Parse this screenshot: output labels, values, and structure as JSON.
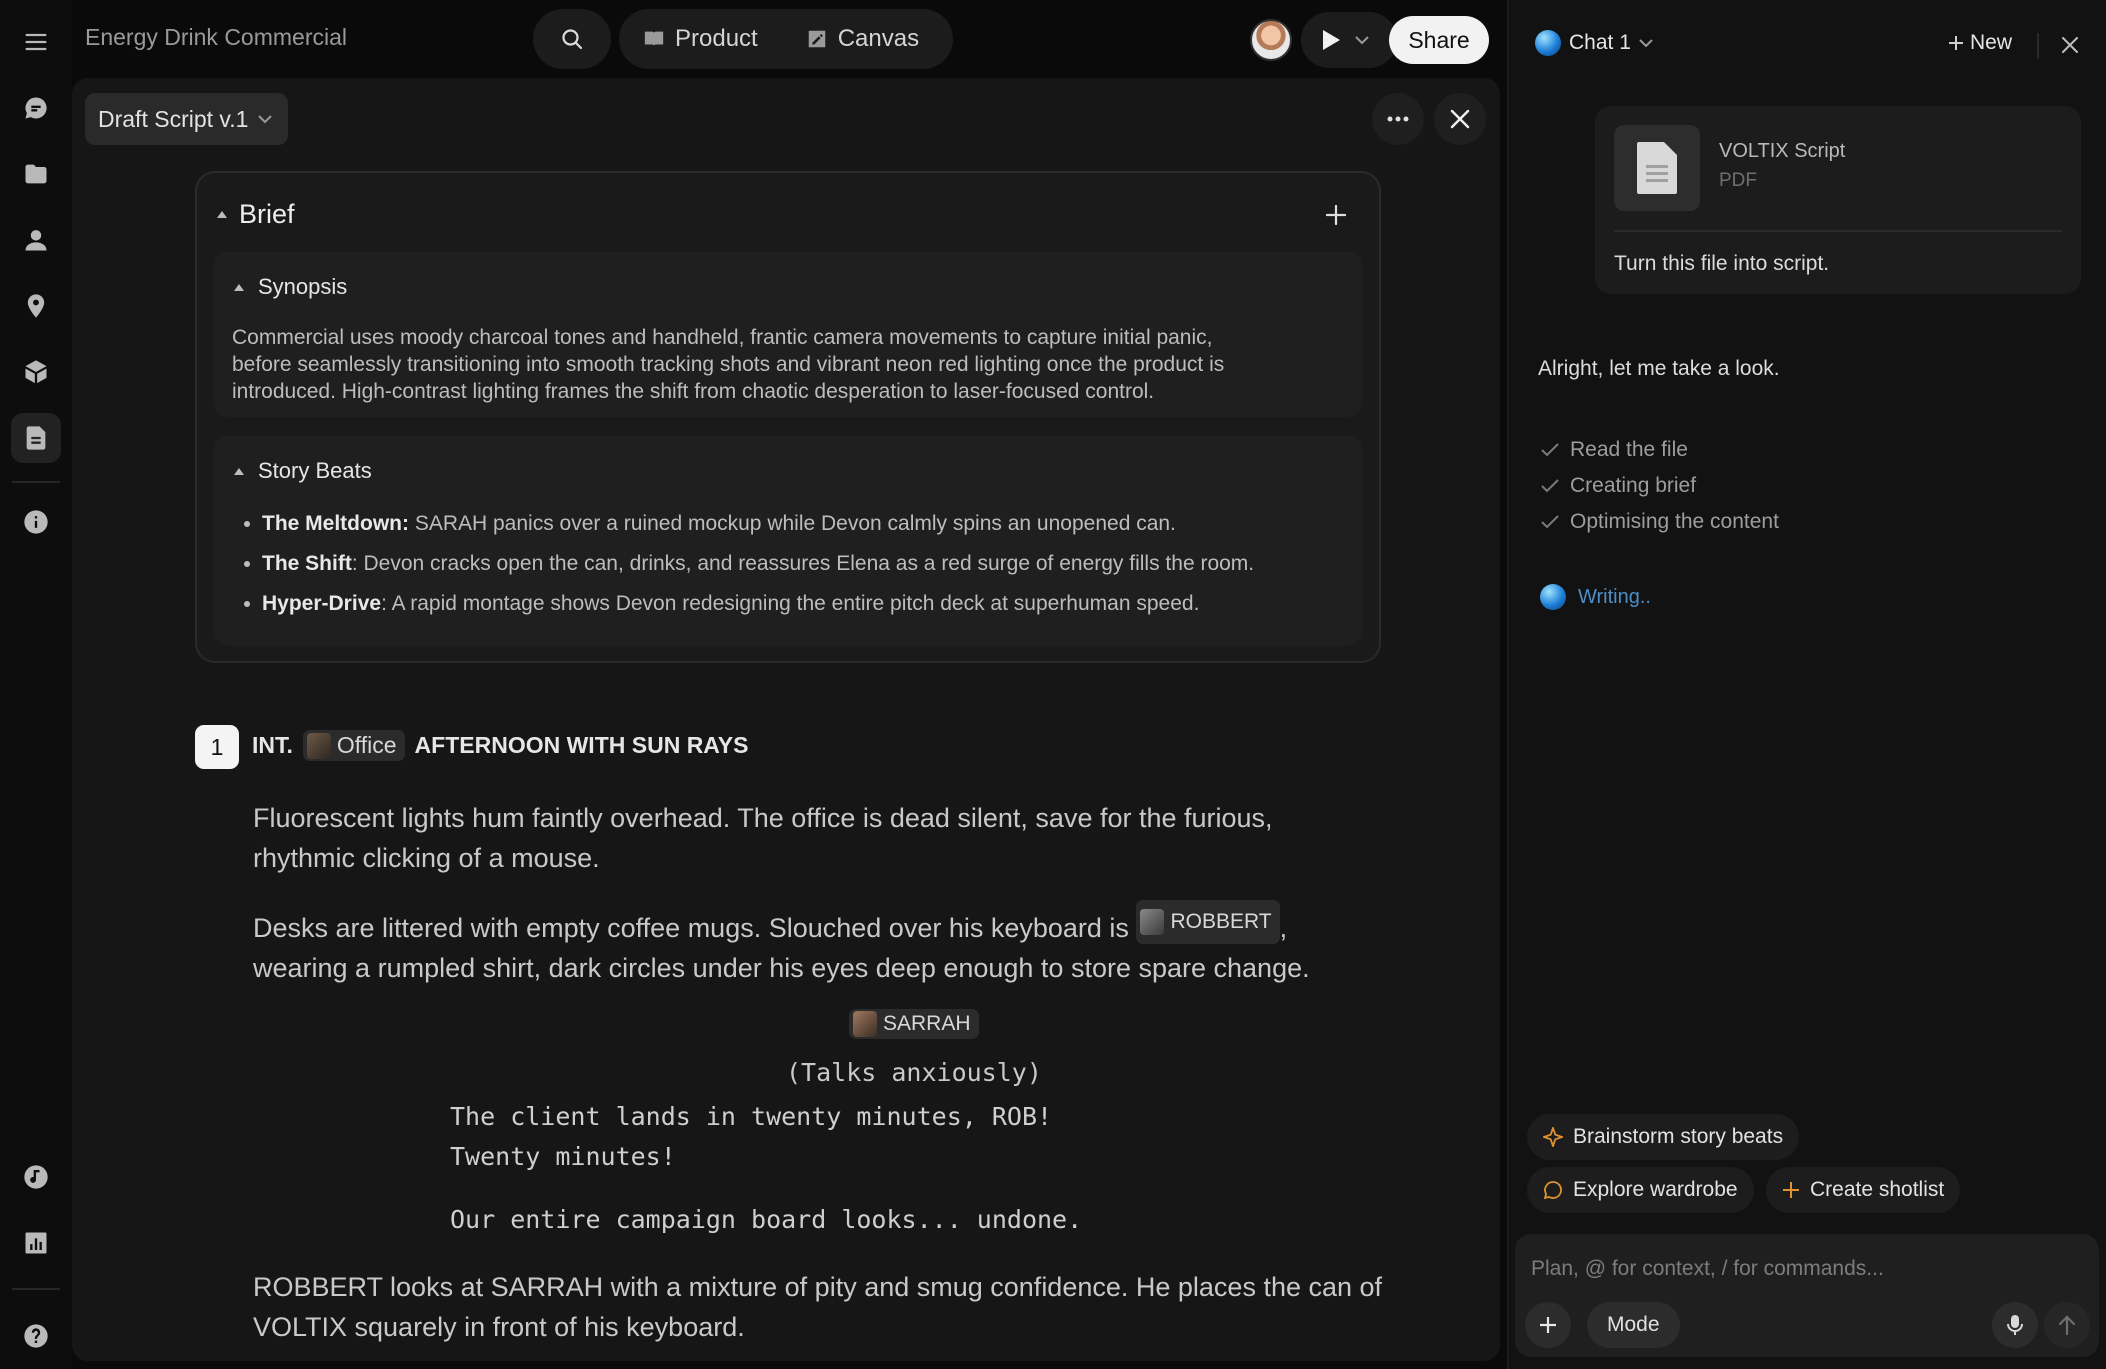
{
  "app": {
    "project_title": "Energy Drink Commercial",
    "tabs": [
      {
        "label": "Product",
        "icon": "book-icon"
      },
      {
        "label": "Canvas",
        "icon": "pencil-square-icon"
      }
    ],
    "share_label": "Share"
  },
  "sidebar": {
    "items": [
      {
        "name": "menu",
        "icon": "hamburger-icon"
      },
      {
        "name": "chats",
        "icon": "chat-bubble-icon"
      },
      {
        "name": "files",
        "icon": "folder-icon"
      },
      {
        "name": "characters",
        "icon": "person-icon"
      },
      {
        "name": "locations",
        "icon": "location-pin-icon"
      },
      {
        "name": "products",
        "icon": "cube-icon"
      },
      {
        "name": "scripts",
        "icon": "document-icon",
        "active": true
      },
      {
        "name": "info",
        "icon": "info-icon"
      },
      {
        "name": "music",
        "icon": "music-note-icon"
      },
      {
        "name": "analytics",
        "icon": "bar-chart-icon"
      },
      {
        "name": "help",
        "icon": "help-icon"
      }
    ]
  },
  "document": {
    "version_label": "Draft Script v.1",
    "brief": {
      "title": "Brief",
      "synopsis_title": "Synopsis",
      "synopsis_lines": [
        "Commercial uses moody charcoal tones and handheld, frantic camera movements to capture initial panic,",
        "before seamlessly transitioning into smooth tracking shots and vibrant neon red lighting once the product is",
        "introduced. High-contrast lighting frames the shift from chaotic desperation to laser-focused control."
      ],
      "beats_title": "Story Beats",
      "beats": [
        {
          "label": "The Meltdown:",
          "text": " SARAH panics over a ruined mockup while Devon calmly spins an unopened can."
        },
        {
          "label": "The Shift",
          "text": ": Devon cracks open the can, drinks, and reassures Elena as a red surge of energy fills the room."
        },
        {
          "label": "Hyper-Drive",
          "text": ": A rapid montage shows Devon redesigning the entire pitch deck at superhuman speed."
        }
      ]
    },
    "scene": {
      "number": "1",
      "int_ext": "INT.",
      "location": "Office",
      "time": "AFTERNOON WITH SUN RAYS",
      "action1_lines": [
        "Fluorescent lights hum faintly overhead. The office is dead silent, save for the furious,",
        "rhythmic clicking of a mouse."
      ],
      "action2_before": "Desks are littered with empty coffee mugs. Slouched over his keyboard is",
      "action2_character": "ROBBERT",
      "action2_after": ",",
      "action2_line2": "wearing a rumpled shirt, dark circles under his eyes deep enough to store spare change.",
      "character": "SARRAH",
      "parenthetical": "(Talks anxiously)",
      "dialogue1": [
        "The client lands in twenty minutes, ROB!",
        "Twenty minutes!"
      ],
      "dialogue2": "Our entire campaign board looks... undone.",
      "action3_lines": [
        "ROBBERT looks at SARRAH with a mixture of pity and smug confidence. He places the can of",
        "VOLTIX squarely in front of his keyboard."
      ]
    }
  },
  "chat": {
    "title": "Chat 1",
    "new_label": "New",
    "attachment": {
      "name": "VOLTIX Script",
      "type": "PDF"
    },
    "user_message": "Turn this file into script.",
    "assistant_message": "Alright, let me take a look.",
    "steps": [
      "Read the file",
      "Creating brief",
      "Optimising the content"
    ],
    "status": "Writing..",
    "suggestions": [
      {
        "label": "Brainstorm story beats",
        "icon": "sparkle-icon"
      },
      {
        "label": "Explore wardrobe",
        "icon": "speech-bubble-icon"
      },
      {
        "label": "Create shotlist",
        "icon": "plus-icon"
      }
    ],
    "input_placeholder": "Plan, @ for context, / for commands...",
    "mode_label": "Mode"
  },
  "colors": {
    "accent_orange": "#e0922f",
    "status_blue": "#4d8ec7",
    "panel_bg": "#161616"
  }
}
